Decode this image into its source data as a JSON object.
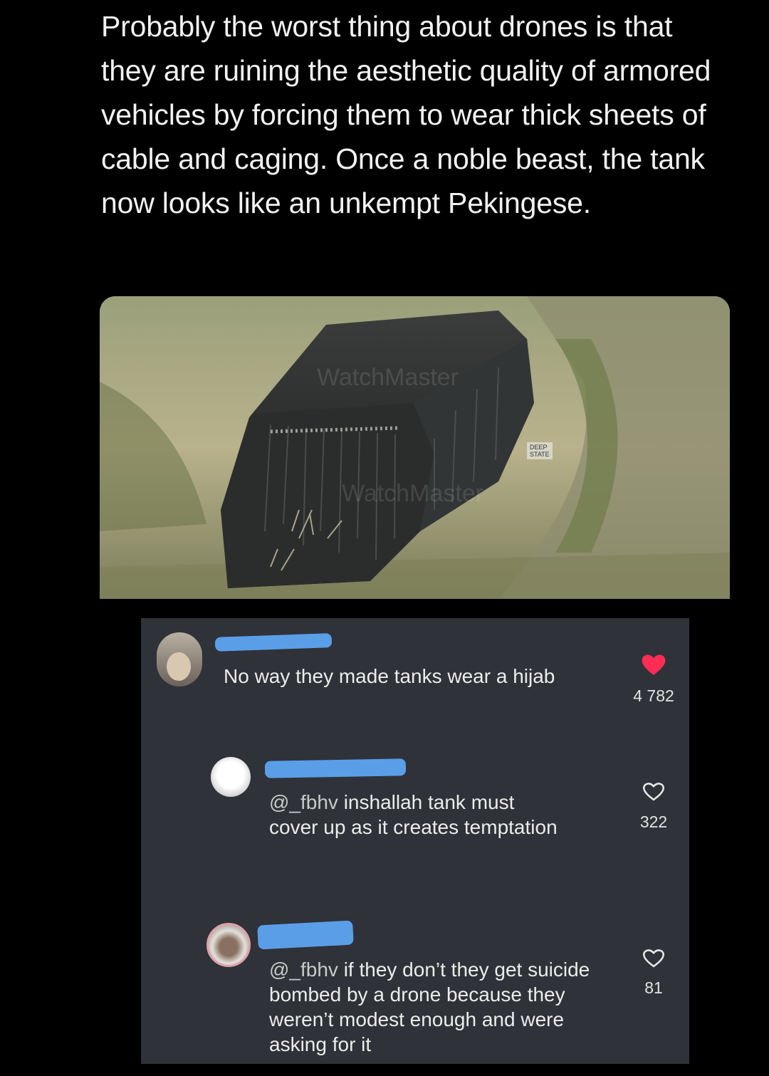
{
  "post": {
    "text": "Probably the worst thing about drones is that they are ruining the aesthetic quality of armored vehicles by forcing them to wear thick sheets of cable and caging. Once a noble beast, the tank now looks like an unkempt Pekingese.",
    "media": {
      "watermark_1": "WatchMaster",
      "watermark_2": "WatchMaster",
      "badge_line1": "DEEP",
      "badge_line2": "STATE"
    }
  },
  "comments": [
    {
      "text": "No way they made tanks wear a hijab",
      "likes": "4 782",
      "liked": true,
      "heart_color": "#ff2d55"
    },
    {
      "mention": "@_fbhv",
      "text": " inshallah tank must cover up as it creates temptation",
      "likes": "322",
      "liked": false
    },
    {
      "mention": "@_fbhv",
      "text": " if they don’t they get suicide bombed by a drone because they weren’t modest enough and were asking for it",
      "likes": "81",
      "liked": false
    }
  ],
  "colors": {
    "background": "#000000",
    "comment_panel": "#2f3238",
    "redaction": "#5b9ee8"
  }
}
